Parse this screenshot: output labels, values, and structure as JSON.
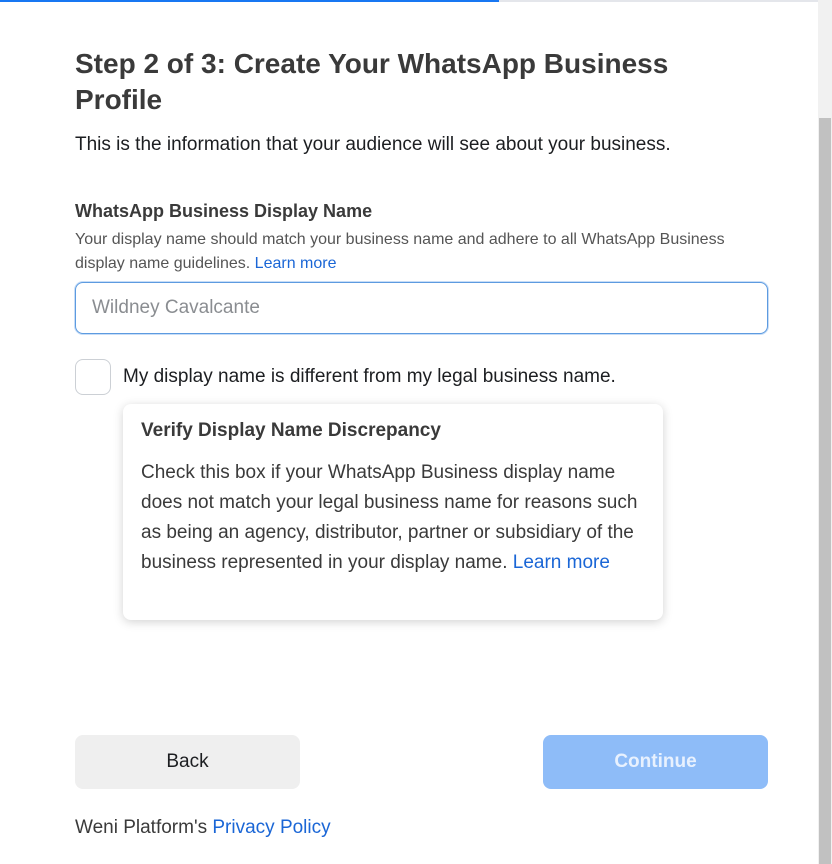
{
  "progress": {
    "fraction": 0.61,
    "color": "#1877f2"
  },
  "header": {
    "title": "Step 2 of 3: Create Your WhatsApp Business Profile",
    "subtitle": "This is the information that your audience will see about your business."
  },
  "display_name": {
    "label": "WhatsApp Business Display Name",
    "help_text": "Your display name should match your business name and adhere to all WhatsApp Business display name guidelines.",
    "help_link": "Learn more",
    "placeholder": "Wildney Cavalcante",
    "value": ""
  },
  "discrepancy_checkbox": {
    "label": "My display name is different from my legal business name.",
    "checked": false
  },
  "tooltip": {
    "title": "Verify Display Name Discrepancy",
    "body": "Check this box if your WhatsApp Business display name does not match your legal business name for reasons such as being an agency, distributor, partner or subsidiary of the business represented in your display name.",
    "link": "Learn more"
  },
  "actions": {
    "back_label": "Back",
    "continue_label": "Continue",
    "continue_disabled": true
  },
  "footer": {
    "prefix": "Weni Platform's",
    "link": "Privacy Policy"
  },
  "colors": {
    "link": "#1a66d6",
    "continue_disabled_bg": "#8ebcf8",
    "back_bg": "#efefef"
  }
}
